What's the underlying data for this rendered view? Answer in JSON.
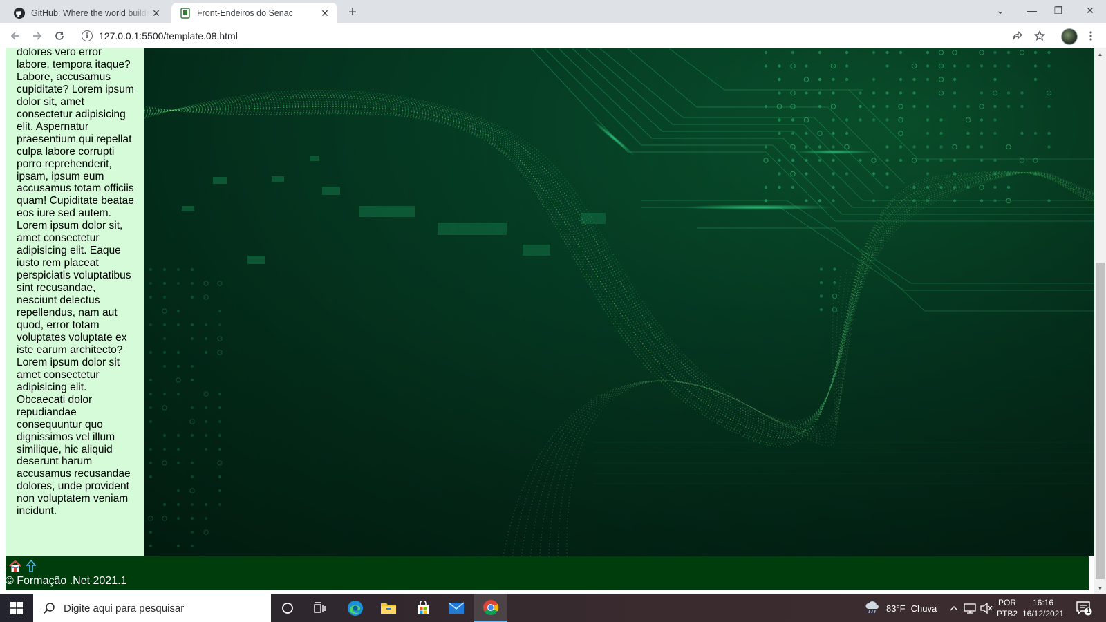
{
  "browser": {
    "tabs": [
      {
        "title": "GitHub: Where the world builds software · GitHub",
        "close": "✕"
      },
      {
        "title": "Front-Endeiros do Senac",
        "close": "✕"
      }
    ],
    "new_tab": "+",
    "url": "127.0.0.1:5500/template.08.html",
    "window_controls": {
      "tab_search": "⌄",
      "minimize": "—",
      "restore": "❐",
      "close": "✕"
    }
  },
  "page": {
    "aside_text": "dolores vero error labore, tempora itaque? Labore, accusamus cupiditate? Lorem ipsum dolor sit, amet consectetur adipisicing elit. Aspernatur praesentium qui repellat culpa labore corrupti porro reprehenderit, ipsam, ipsum eum accusamus totam officiis quam! Cupiditate beatae eos iure sed autem. Lorem ipsum dolor sit, amet consectetur adipisicing elit. Eaque iusto rem placeat perspiciatis voluptatibus sint recusandae, nesciunt delectus repellendus, nam aut quod, error totam voluptates voluptate ex iste earum architecto? Lorem ipsum dolor sit amet consectetur adipisicing elit. Obcaecati dolor repudiandae consequuntur quo dignissimos vel illum similique, hic aliquid deserunt harum accusamus recusandae dolores, unde provident non voluptatem veniam incidunt.",
    "footer": {
      "home_icon": "🏠",
      "up_icon": "⇧",
      "copyright": "© Formação .Net 2021.1"
    }
  },
  "taskbar": {
    "search_placeholder": "Digite aqui para pesquisar",
    "weather": {
      "temp": "83°F",
      "condition": "Chuva"
    },
    "language": {
      "line1": "POR",
      "line2": "PTB2"
    },
    "time": "16:16",
    "date": "16/12/2021",
    "notifications_count": "1"
  },
  "colors": {
    "aside_bg": "#d6fbd9",
    "footer_bg": "#003d0c",
    "hero_green": "#06472a"
  }
}
